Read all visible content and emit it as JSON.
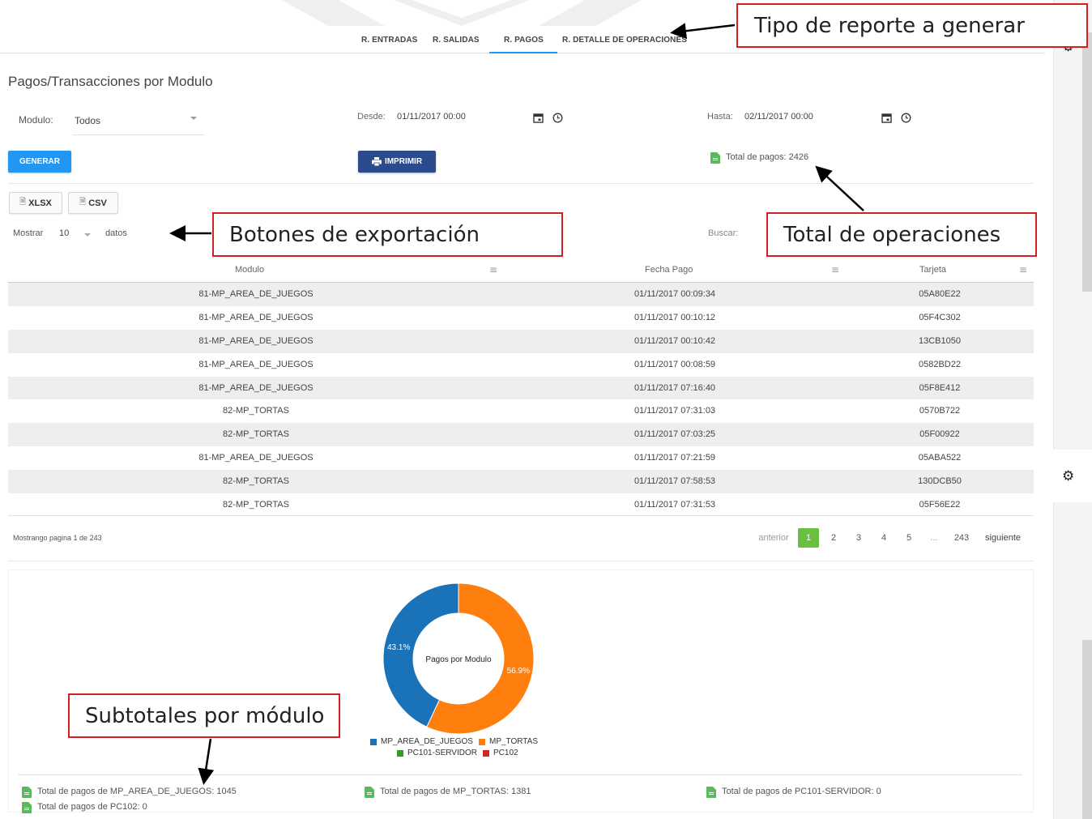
{
  "tabs": [
    "R. ENTRADAS",
    "R. SALIDAS",
    "R. PAGOS",
    "R. DETALLE DE OPERACIONES"
  ],
  "active_tab": "R. PAGOS",
  "page_title": "Pagos/Transacciones por Modulo",
  "filters": {
    "modulo_label": "Modulo:",
    "modulo_value": "Todos",
    "desde_label": "Desde:",
    "desde_value": "01/11/2017 00:00",
    "hasta_label": "Hasta:",
    "hasta_value": "02/11/2017 00:00"
  },
  "buttons": {
    "generar": "GENERAR",
    "imprimir": "IMPRIMIR",
    "xlsx": "XLSX",
    "csv": "CSV"
  },
  "total_pagos": "Total de pagos: 2426",
  "length_control": {
    "mostrar": "Mostrar",
    "value": "10",
    "datos": "datos"
  },
  "search_label": "Buscar:",
  "table": {
    "columns": [
      "Modulo",
      "Fecha Pago",
      "Tarjeta"
    ],
    "rows": [
      [
        "81-MP_AREA_DE_JUEGOS",
        "01/11/2017 00:09:34",
        "05A80E22"
      ],
      [
        "81-MP_AREA_DE_JUEGOS",
        "01/11/2017 00:10:12",
        "05F4C302"
      ],
      [
        "81-MP_AREA_DE_JUEGOS",
        "01/11/2017 00:10:42",
        "13CB1050"
      ],
      [
        "81-MP_AREA_DE_JUEGOS",
        "01/11/2017 00:08:59",
        "0582BD22"
      ],
      [
        "81-MP_AREA_DE_JUEGOS",
        "01/11/2017 07:16:40",
        "05F8E412"
      ],
      [
        "82-MP_TORTAS",
        "01/11/2017 07:31:03",
        "0570B722"
      ],
      [
        "82-MP_TORTAS",
        "01/11/2017 07:03:25",
        "05F00922"
      ],
      [
        "81-MP_AREA_DE_JUEGOS",
        "01/11/2017 07:21:59",
        "05ABA522"
      ],
      [
        "82-MP_TORTAS",
        "01/11/2017 07:58:53",
        "130DCB50"
      ],
      [
        "82-MP_TORTAS",
        "01/11/2017 07:31:53",
        "05F56E22"
      ]
    ]
  },
  "pagination": {
    "info": "Mostrango pagina 1 de 243",
    "prev": "anterior",
    "pages": [
      "1",
      "2",
      "3",
      "4",
      "5",
      "...",
      "243"
    ],
    "active": "1",
    "next": "siguiente"
  },
  "chart_data": {
    "type": "pie",
    "title": "Pagos por Modulo",
    "categories": [
      "MP_AREA_DE_JUEGOS",
      "MP_TORTAS",
      "PC101-SERVIDOR",
      "PC102"
    ],
    "values": [
      1045,
      1381,
      0,
      0
    ],
    "percent_labels": [
      "43.1%",
      "56.9%"
    ],
    "colors": [
      "#1a73b8",
      "#ff7f0e",
      "#2ca02c",
      "#d62728"
    ],
    "legend_position": "bottom"
  },
  "subtotals": [
    "Total de pagos de MP_AREA_DE_JUEGOS: 1045",
    "Total de pagos de MP_TORTAS: 1381",
    "Total de pagos de PC101-SERVIDOR: 0",
    "Total de pagos de PC102: 0"
  ],
  "annotations": {
    "tipo_reporte": "Tipo de reporte a generar",
    "botones_exportacion": "Botones de exportación",
    "total_operaciones": "Total de operaciones",
    "subtotales": "Subtotales por módulo"
  },
  "icons": {
    "calendar": "calendar-icon",
    "clock": "clock-icon",
    "gear": "gear-icon",
    "print": "print-icon",
    "document": "document-icon",
    "sort": "sort-icon"
  }
}
